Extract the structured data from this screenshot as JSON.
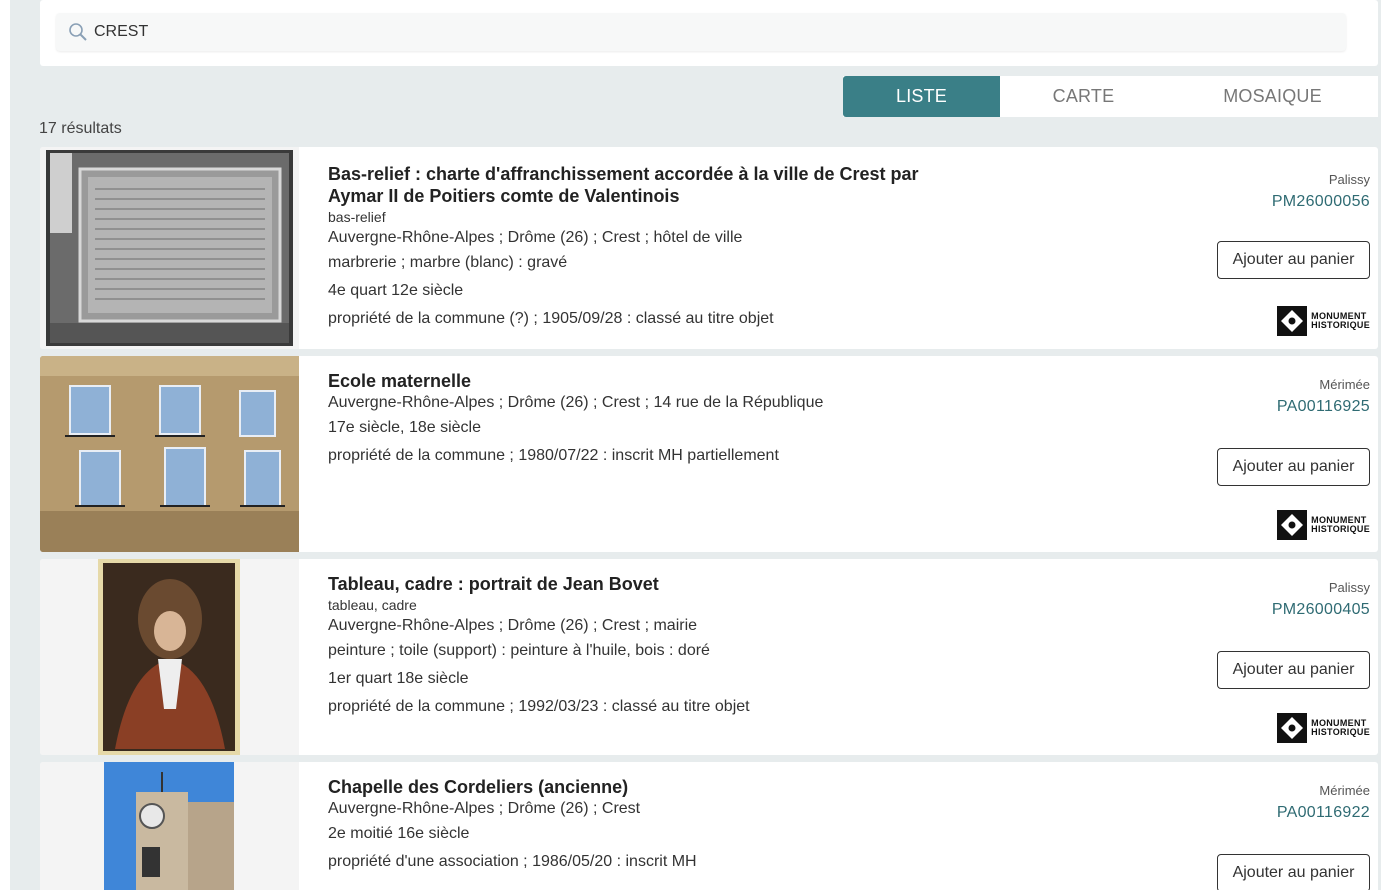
{
  "search": {
    "value": "CREST",
    "icon": "search-icon"
  },
  "tabs": [
    {
      "label": "LISTE",
      "active": true
    },
    {
      "label": "CARTE",
      "active": false
    },
    {
      "label": "MOSAIQUE",
      "active": false
    }
  ],
  "results_count": "17 résultats",
  "colors": {
    "accent": "#3a7f87",
    "ref": "#2f6b73",
    "background": "#e7eced"
  },
  "results": [
    {
      "title": "Bas-relief : charte d'affranchissement accordée à la ville de Crest par Aymar II de Poitiers comte de Valentinois",
      "subtitle": "bas-relief",
      "lines": [
        "Auvergne-Rhône-Alpes ; Drôme (26) ; Crest ; hôtel de ville",
        "marbrerie ; marbre (blanc) : gravé",
        "4e quart 12e siècle",
        "propriété de la commune (?) ; 1905/09/28 : classé au titre objet"
      ],
      "base": "Palissy",
      "ref": "PM26000056",
      "button": "Ajouter au panier",
      "logo": {
        "line1": "MONUMENT",
        "line2": "HISTORIQUE"
      }
    },
    {
      "title": "Ecole maternelle",
      "subtitle": "",
      "lines": [
        "Auvergne-Rhône-Alpes ; Drôme (26) ; Crest ; 14 rue de la République",
        "17e siècle, 18e siècle",
        "propriété de la commune ; 1980/07/22 : inscrit MH partiellement"
      ],
      "base": "Mérimée",
      "ref": "PA00116925",
      "button": "Ajouter au panier",
      "logo": {
        "line1": "MONUMENT",
        "line2": "HISTORIQUE"
      }
    },
    {
      "title": "Tableau, cadre : portrait de Jean Bovet",
      "subtitle": "tableau, cadre",
      "lines": [
        "Auvergne-Rhône-Alpes ; Drôme (26) ; Crest ; mairie",
        "peinture ; toile (support) : peinture à l'huile, bois : doré",
        "1er quart 18e siècle",
        "propriété de la commune ; 1992/03/23 : classé au titre objet"
      ],
      "base": "Palissy",
      "ref": "PM26000405",
      "button": "Ajouter au panier",
      "logo": {
        "line1": "MONUMENT",
        "line2": "HISTORIQUE"
      }
    },
    {
      "title": "Chapelle des Cordeliers (ancienne)",
      "subtitle": "",
      "lines": [
        "Auvergne-Rhône-Alpes ; Drôme (26) ; Crest",
        "2e moitié 16e siècle",
        "propriété d'une association ; 1986/05/20 : inscrit MH"
      ],
      "base": "Mérimée",
      "ref": "PA00116922",
      "button": "Ajouter au panier"
    }
  ]
}
